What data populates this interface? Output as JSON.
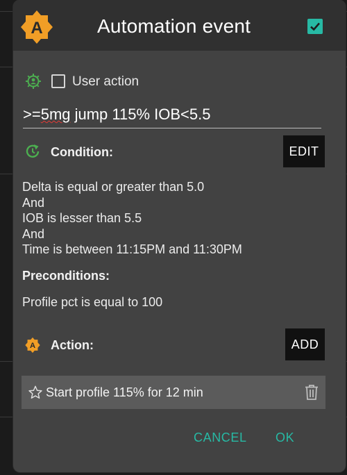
{
  "dialog": {
    "title": "Automation event",
    "enabled_checked": true
  },
  "user_action": {
    "label": "User action",
    "checked": false
  },
  "event_name": {
    "prefix": ">=",
    "misspelled": "5mg",
    "suffix": " jump 115% IOB<5.5"
  },
  "condition": {
    "label": "Condition:",
    "edit_label": "EDIT",
    "lines": [
      "Delta is equal or greater than 5.0",
      "And",
      "IOB is lesser than 5.5",
      "And",
      "Time is between 11:15PM and 11:30PM"
    ]
  },
  "preconditions": {
    "label": "Preconditions:",
    "text": "Profile pct is equal to 100"
  },
  "action": {
    "label": "Action:",
    "add_label": "ADD",
    "items": [
      {
        "text": "Start profile 115% for 12 min",
        "icon": "star-outline-icon"
      }
    ]
  },
  "footer": {
    "cancel_label": "CANCEL",
    "ok_label": "OK"
  },
  "colors": {
    "accent": "#27b9a4",
    "logo_orange": "#f19e26",
    "condition_green": "#4caf50",
    "dialog_bg": "#424242",
    "titlebar_bg": "#303030"
  }
}
